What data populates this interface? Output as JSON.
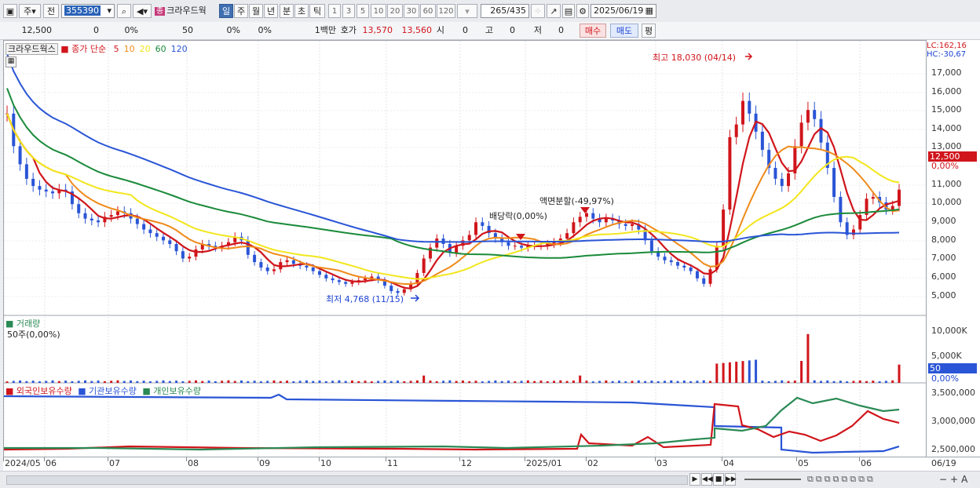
{
  "toolbar": {
    "type_select": "주",
    "prev_label": "전",
    "stock_code": "355390",
    "stock_name_badge": "종",
    "stock_name": "크라우드웍",
    "periods": [
      "일",
      "주",
      "월",
      "년",
      "분",
      "초",
      "틱"
    ],
    "active_period": "일",
    "minute_options": [
      "1",
      "3",
      "5",
      "10",
      "20",
      "30",
      "60",
      "120"
    ],
    "count_value": "265",
    "count_total": "/435",
    "date": "2025/06/19"
  },
  "quote_bar": {
    "price": "12,500",
    "change": "0",
    "change_pct": "0%",
    "volume": "50",
    "vol_pct": "0%",
    "vol_pct2": "0%",
    "unit": "1백만",
    "ask_label": "호가",
    "ask": "13,570",
    "bid": "13,560",
    "open_label": "시",
    "open": "0",
    "high_label": "고",
    "high": "0",
    "low_label": "저",
    "low": "0",
    "buy_label": "매수",
    "sell_label": "매도",
    "eval_label": "평"
  },
  "price_panel": {
    "name_tag": "크라우드웍스",
    "ma_label": "종가 단순",
    "ma_periods": [
      {
        "label": "5",
        "color": "#d0151b"
      },
      {
        "label": "10",
        "color": "#ef8a1a"
      },
      {
        "label": "20",
        "color": "#f2e61c"
      },
      {
        "label": "60",
        "color": "#1a8a3a"
      },
      {
        "label": "120",
        "color": "#2a55d6"
      }
    ],
    "lc_label": "LC:162,16",
    "hc_label": "HC:-30,67",
    "high_annotation": "최고 18,030 (04/14)",
    "low_annotation": "최저 4,768 (11/15)",
    "split_annotation": "액면분할(-49,97%)",
    "dividend_annotation": "배당락(0,00%)",
    "current_price_tag": "12,500",
    "current_pct_tag": "0,00%",
    "y_ticks": [
      "17,000",
      "16,000",
      "15,000",
      "14,000",
      "13,000",
      "11,000",
      "10,000",
      "9,000",
      "8,000",
      "7,000",
      "6,000",
      "5,000"
    ]
  },
  "volume_panel": {
    "title": "거래량",
    "value_label": "50주(0,00%)",
    "y_ticks": [
      "10,000K",
      "5,000K"
    ],
    "current_tag": "50",
    "current_pct": "0,00%"
  },
  "holdings_panel": {
    "legend": [
      {
        "label": "외국인보유수량",
        "color": "#d0151b"
      },
      {
        "label": "기관보유수량",
        "color": "#2a55d6"
      },
      {
        "label": "개인보유수량",
        "color": "#2a8a55"
      }
    ],
    "y_ticks": [
      "3,500,000",
      "3,000,000",
      "2,500,000"
    ]
  },
  "x_axis": {
    "labels": [
      "2024/05",
      "06",
      "07",
      "08",
      "09",
      "10",
      "11",
      "12",
      "2025/01",
      "02",
      "03",
      "04",
      "05",
      "06"
    ],
    "end_label": "06/19"
  },
  "colors": {
    "ma5": "#d0151b",
    "ma10": "#ef8a1a",
    "ma20": "#f2e61c",
    "ma60": "#1a8a3a",
    "ma120": "#2a55d6",
    "up": "#d0151b",
    "down": "#2a55d6"
  }
}
